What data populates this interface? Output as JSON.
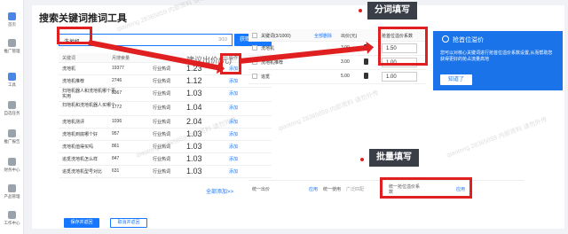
{
  "nav": [
    {
      "label": "首页",
      "icon": "home-icon"
    },
    {
      "label": "推广管理",
      "icon": "promotion-icon"
    },
    {
      "label": "工具",
      "icon": "tool-icon"
    },
    {
      "label": "自选任务",
      "icon": "task-icon"
    },
    {
      "label": "推广报告",
      "icon": "report-icon"
    },
    {
      "label": "财务中心",
      "icon": "finance-icon"
    },
    {
      "label": "产品管理",
      "icon": "product-icon"
    },
    {
      "label": "工作中心",
      "icon": "work-icon"
    }
  ],
  "page": {
    "title": "搜索关键词推词工具",
    "search_value": "洗地机",
    "search_count": "3/10",
    "get_keywords_button": "获取关键词",
    "more_link": "全部添加>>",
    "save_button": "保存并返回",
    "cancel_button": "取消并返回"
  },
  "left_table": {
    "headers": {
      "keyword": "关键词",
      "volume": "月搜索量",
      "category": "",
      "bid": "建议出价(元)",
      "op": "操作"
    },
    "rows": [
      {
        "keyword": "洗地机",
        "volume": "19377",
        "category": "行业热词",
        "bid": "1.23",
        "op": "添加"
      },
      {
        "keyword": "洗地机推荐",
        "volume": "2746",
        "category": "行业热词",
        "bid": "1.12",
        "op": "添加"
      },
      {
        "keyword": "扫地机器人和洗地机哪个更实用",
        "volume": "2367",
        "category": "行业热词",
        "bid": "1.03",
        "op": "添加"
      },
      {
        "keyword": "扫地机和洗地机器人买哪个",
        "volume": "1772",
        "category": "行业热词",
        "bid": "1.04",
        "op": "添加"
      },
      {
        "keyword": "洗地机测评",
        "volume": "1036",
        "category": "行业热词",
        "bid": "2.04",
        "op": "添加"
      },
      {
        "keyword": "洗地机到底哪个好",
        "volume": "957",
        "category": "行业热词",
        "bid": "1.03",
        "op": "添加"
      },
      {
        "keyword": "洗地机值得买吗",
        "volume": "861",
        "category": "行业热词",
        "bid": "1.03",
        "op": "添加"
      },
      {
        "keyword": "追觅洗地机怎么样",
        "volume": "847",
        "category": "行业热词",
        "bid": "1.03",
        "op": "添加"
      },
      {
        "keyword": "追觅洗地机型号对比",
        "volume": "631",
        "category": "行业热词",
        "bid": "1.03",
        "op": "添加"
      }
    ]
  },
  "right_table": {
    "headers": {
      "keyword": "关键词(3/1000)",
      "delete_all": "全部删除",
      "bid": "出价(元)",
      "premium": "抢首位溢价系数"
    },
    "rows": [
      {
        "keyword": "洗地机",
        "bid": "3.00",
        "premium": "1.50"
      },
      {
        "keyword": "洗地机推荐",
        "bid": "3.00",
        "premium": "1.00"
      },
      {
        "keyword": "追觅",
        "bid": "5.00",
        "premium": "1.00"
      }
    ],
    "bulk": {
      "bid_label": "统一出价",
      "bid_apply": "应用",
      "match_label": "统一使用",
      "match_value": "广泛匹配",
      "premium_label": "统一抢位溢价系数",
      "premium_apply": "应用"
    }
  },
  "tooltip": {
    "title": "抢首位溢价",
    "text": "您可以对核心关键词进行抢首位溢价系数设置,从而帮助您获得更好的抢占流量高地",
    "button": "知道了"
  },
  "callouts": {
    "split_fill": "分词填写",
    "bulk_fill": "批量填写"
  },
  "watermark": "qiaotong 28365859 内部资料 请勿外传",
  "colors": {
    "accent": "#1677ff",
    "highlight": "#e02020",
    "tooltip": "#1a73e8"
  }
}
